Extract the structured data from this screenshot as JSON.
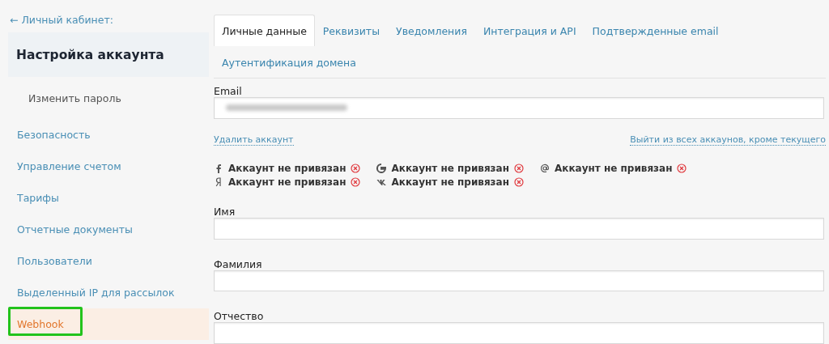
{
  "sidebar": {
    "back_link": "← Личный кабинет:",
    "title": "Настройка аккаунта",
    "items": [
      {
        "label": "Изменить пароль",
        "kind": "sub",
        "selected": false,
        "highlighted": false
      },
      {
        "label": "Безопасность",
        "kind": "main",
        "selected": false,
        "highlighted": false
      },
      {
        "label": "Управление счетом",
        "kind": "main",
        "selected": false,
        "highlighted": false
      },
      {
        "label": "Тарифы",
        "kind": "main",
        "selected": false,
        "highlighted": false
      },
      {
        "label": "Отчетные документы",
        "kind": "main",
        "selected": false,
        "highlighted": false
      },
      {
        "label": "Пользователи",
        "kind": "main",
        "selected": false,
        "highlighted": false
      },
      {
        "label": "Выделенный IP для рассылок",
        "kind": "main",
        "selected": false,
        "highlighted": false
      },
      {
        "label": "Webhook",
        "kind": "main",
        "selected": true,
        "highlighted": true
      }
    ]
  },
  "tabs": [
    {
      "label": "Личные данные",
      "selected": true
    },
    {
      "label": "Реквизиты",
      "selected": false
    },
    {
      "label": "Уведомления",
      "selected": false
    },
    {
      "label": "Интеграция и API",
      "selected": false
    },
    {
      "label": "Подтвержденные email",
      "selected": false
    },
    {
      "label": "Аутентификация домена",
      "selected": false
    }
  ],
  "email": {
    "label": "Email"
  },
  "links": {
    "delete": "Удалить аккаунт",
    "logout_others": "Выйти из всех аккаунов, кроме текущего"
  },
  "social": [
    {
      "kind": "facebook",
      "status": "Аккаунт не привязан"
    },
    {
      "kind": "google",
      "status": "Аккаунт не привязан"
    },
    {
      "kind": "mail",
      "status": "Аккаунт не привязан"
    },
    {
      "kind": "yandex",
      "status": "Аккаунт не привязан"
    },
    {
      "kind": "vk",
      "status": "Аккаунт не привязан"
    }
  ],
  "fields": [
    {
      "label": "Имя"
    },
    {
      "label": "Фамилия"
    },
    {
      "label": "Отчество"
    }
  ]
}
